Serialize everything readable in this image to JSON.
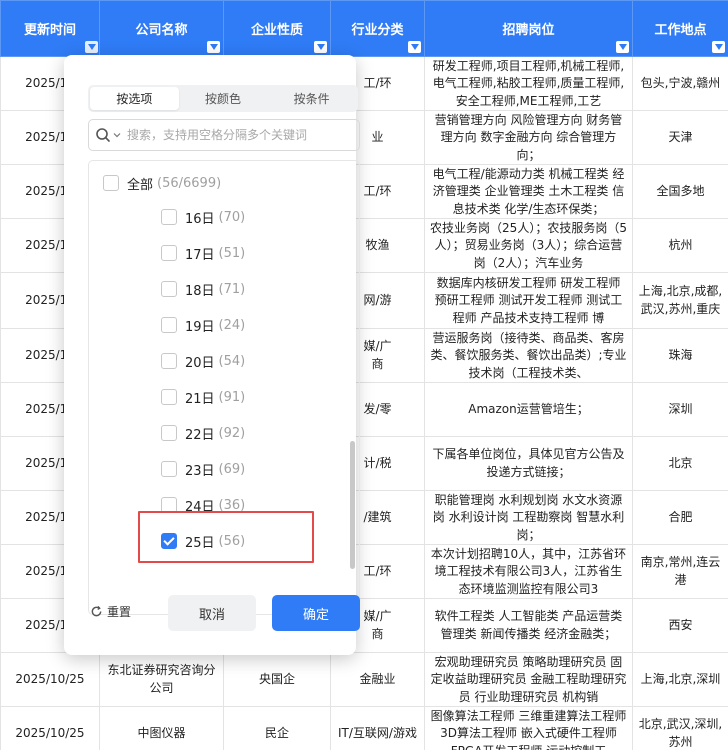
{
  "table": {
    "headers": [
      "更新时间",
      "公司名称",
      "企业性质",
      "行业分类",
      "招聘岗位",
      "工作地点"
    ],
    "rows": [
      {
        "date": "2025/10",
        "company": "",
        "nature": "",
        "industry": "工/环",
        "positions": "研发工程师,项目工程师,机械工程师,电气工程师,粘胶工程师,质量工程师,安全工程师,ME工程师,工艺",
        "location": "包头,宁波,赣州"
      },
      {
        "date": "2025/10",
        "company": "",
        "nature": "",
        "industry": "业",
        "positions": "营销管理方向 风险管理方向 财务管理方向 数字金融方向 综合管理方向；",
        "location": "天津"
      },
      {
        "date": "2025/10",
        "company": "",
        "nature": "",
        "industry": "工/环",
        "positions": "电气工程/能源动力类 机械工程类 经济管理类 企业管理类 土木工程类 信息技术类 化学/生态环保类；",
        "location": "全国多地"
      },
      {
        "date": "2025/10",
        "company": "",
        "nature": "",
        "industry": "牧渔",
        "positions": "农技业务岗（25人）；农技服务岗（5人）；贸易业务岗（3人）；综合运营岗（2人）；汽车业务",
        "location": "杭州"
      },
      {
        "date": "2025/10",
        "company": "",
        "nature": "",
        "industry": "网/游",
        "positions": "数据库内核研发工程师 研发工程师 预研工程师 测试开发工程师 测试工程师 产品技术支持工程师 博",
        "location": "上海,北京,成都,武汉,苏州,重庆"
      },
      {
        "date": "2025/10",
        "company": "",
        "nature": "",
        "industry": "媒/广\n商",
        "positions": "营运服务岗（接待类、商品类、客房类、餐饮服务类、餐饮出品类）;专业技术岗（工程技术类、",
        "location": "珠海"
      },
      {
        "date": "2025/10",
        "company": "",
        "nature": "",
        "industry": "发/零",
        "positions": "Amazon运营管培生；",
        "location": "深圳"
      },
      {
        "date": "2025/10",
        "company": "",
        "nature": "",
        "industry": "计/税",
        "positions": "下属各单位岗位，具体见官方公告及投递方式链接；",
        "location": "北京"
      },
      {
        "date": "2025/10",
        "company": "",
        "nature": "",
        "industry": "/建筑",
        "positions": "职能管理岗 水利规划岗 水文水资源岗 水利设计岗 工程勘察岗 智慧水利岗；",
        "location": "合肥"
      },
      {
        "date": "2025/10",
        "company": "",
        "nature": "",
        "industry": "工/环",
        "positions": "本次计划招聘10人，其中，江苏省环境工程技术有限公司3人，江苏省生态环境监测监控有限公司3",
        "location": "南京,常州,连云港"
      },
      {
        "date": "2025/10",
        "company": "",
        "nature": "",
        "industry": "媒/广\n商",
        "positions": "软件工程类 人工智能类 产品运营类 管理类 新闻传播类 经济金融类；",
        "location": "西安"
      },
      {
        "date": "2025/10/25",
        "company": "东北证券研究咨询分公司",
        "nature": "央国企",
        "industry": "金融业",
        "positions": "宏观助理研究员 策略助理研究员 固定收益助理研究员 金融工程助理研究员 行业助理研究员 机构销",
        "location": "上海,北京,深圳"
      },
      {
        "date": "2025/10/25",
        "company": "中图仪器",
        "nature": "民企",
        "industry": "IT/互联网/游戏",
        "positions": "图像算法工程师 三维重建算法工程师 3D算法工程师 嵌入式硬件工程师 FPGA开发工程师 运动控制工",
        "location": "北京,武汉,深圳,苏州"
      }
    ]
  },
  "filter": {
    "tabs": [
      "按选项",
      "按颜色",
      "按条件"
    ],
    "search_placeholder": "搜索，支持用空格分隔多个关键词",
    "select_all": {
      "label": "全部",
      "count": "(56/6699)"
    },
    "items": [
      {
        "label": "16日",
        "count": "(70)",
        "checked": false
      },
      {
        "label": "17日",
        "count": "(51)",
        "checked": false
      },
      {
        "label": "18日",
        "count": "(71)",
        "checked": false
      },
      {
        "label": "19日",
        "count": "(24)",
        "checked": false
      },
      {
        "label": "20日",
        "count": "(54)",
        "checked": false
      },
      {
        "label": "21日",
        "count": "(91)",
        "checked": false
      },
      {
        "label": "22日",
        "count": "(92)",
        "checked": false
      },
      {
        "label": "23日",
        "count": "(69)",
        "checked": false
      },
      {
        "label": "24日",
        "count": "(36)",
        "checked": false
      },
      {
        "label": "25日",
        "count": "(56)",
        "checked": true
      }
    ],
    "reset_label": "重置",
    "cancel_label": "取消",
    "confirm_label": "确定"
  },
  "colors": {
    "accent": "#2f7cf6",
    "highlight": "#e34b4b"
  }
}
